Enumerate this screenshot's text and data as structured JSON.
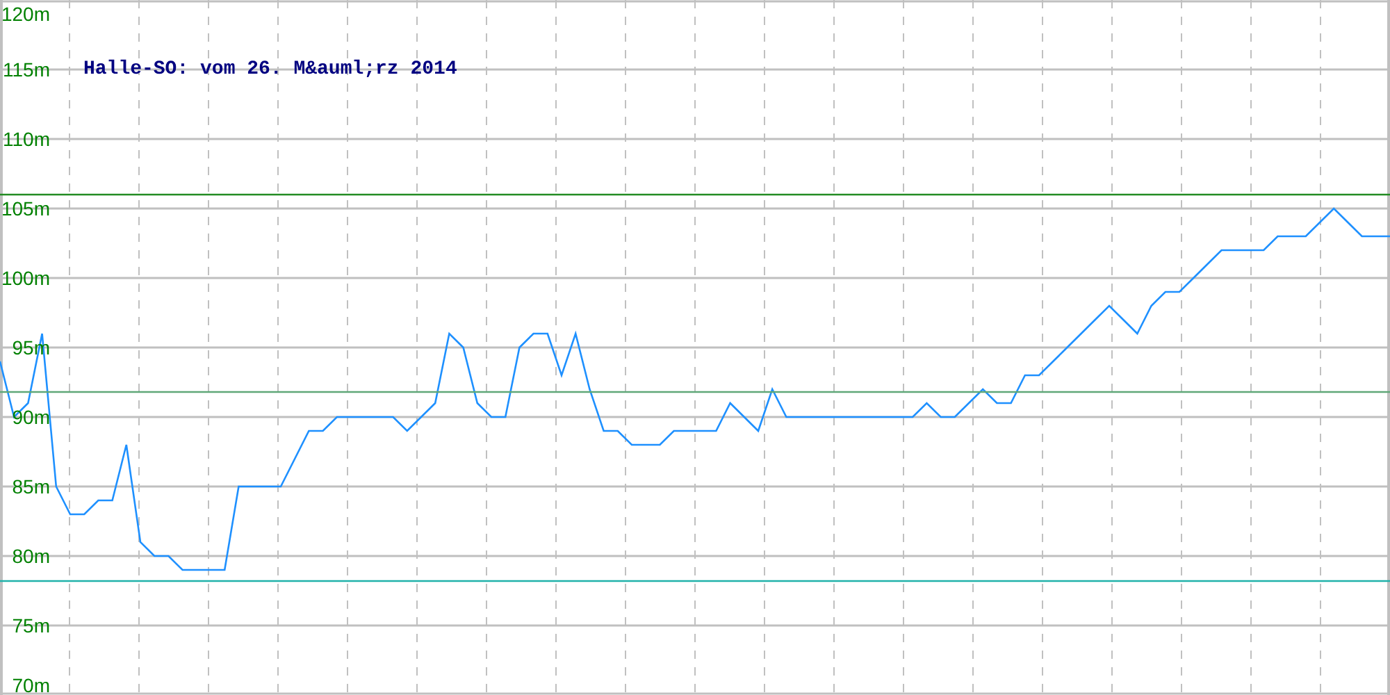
{
  "chart": {
    "chart_data": {
      "type": "line",
      "title": "Halle-SO: vom 26. M&auml;rz 2014",
      "ylim": [
        70,
        120
      ],
      "yticks": [
        {
          "value": 120,
          "label": "120m"
        },
        {
          "value": 115,
          "label": "115m"
        },
        {
          "value": 110,
          "label": "110m"
        },
        {
          "value": 105,
          "label": "105m"
        },
        {
          "value": 100,
          "label": "100m"
        },
        {
          "value": 95,
          "label": "95m"
        },
        {
          "value": 90,
          "label": "90m"
        },
        {
          "value": 85,
          "label": "85m"
        },
        {
          "value": 80,
          "label": "80m"
        },
        {
          "value": 75,
          "label": "75m"
        },
        {
          "value": 70,
          "label": "70m"
        }
      ],
      "series": [
        {
          "color": "#1e90ff",
          "values": [
            94,
            90,
            91,
            96,
            85,
            83,
            83,
            84,
            84,
            88,
            81,
            80,
            80,
            79,
            79,
            79,
            79,
            85,
            85,
            85,
            85,
            87,
            89,
            89,
            90,
            90,
            90,
            90,
            90,
            89,
            90,
            91,
            96,
            95,
            91,
            90,
            90,
            95,
            96,
            96,
            93,
            96,
            92,
            89,
            89,
            88,
            88,
            88,
            89,
            89,
            89,
            89,
            91,
            90,
            89,
            92,
            90,
            90,
            90,
            90,
            90,
            90,
            90,
            90,
            90,
            90,
            91,
            90,
            90,
            91,
            92,
            91,
            91,
            93,
            93,
            94,
            95,
            96,
            97,
            98,
            97,
            96,
            98,
            99,
            99,
            100,
            101,
            102,
            102,
            102,
            102,
            103,
            103,
            103,
            104,
            105,
            104,
            103,
            103,
            103
          ]
        },
        {
          "color": "#228b22",
          "values": [
            106,
            106,
            106,
            106,
            106,
            106,
            106,
            106,
            106,
            106,
            106,
            106,
            106,
            106,
            106,
            106,
            106,
            106,
            106,
            106,
            106,
            106,
            106,
            106,
            106,
            106,
            106,
            106,
            106,
            106,
            106,
            106,
            106,
            106,
            106,
            106,
            106,
            106,
            106,
            106,
            106,
            106,
            106,
            106,
            106,
            106,
            106,
            106,
            106,
            106,
            106,
            106,
            106,
            106,
            106,
            106,
            106,
            106,
            106,
            106,
            106,
            106,
            106,
            106,
            106,
            106,
            106,
            106,
            106,
            106,
            106,
            106,
            106,
            106,
            106,
            106,
            106,
            106,
            106,
            106,
            106,
            106,
            106,
            106,
            106,
            106,
            106,
            106,
            106,
            106,
            106,
            106,
            106,
            106,
            106,
            106,
            106,
            106,
            106,
            106
          ]
        },
        {
          "color": "#5fa878",
          "values": [
            91.8,
            91.8,
            91.8,
            91.8,
            91.8,
            91.8,
            91.8,
            91.8,
            91.8,
            91.8,
            91.8,
            91.8,
            91.8,
            91.8,
            91.8,
            91.8,
            91.8,
            91.8,
            91.8,
            91.8,
            91.8,
            91.8,
            91.8,
            91.8,
            91.8,
            91.8,
            91.8,
            91.8,
            91.8,
            91.8,
            91.8,
            91.8,
            91.8,
            91.8,
            91.8,
            91.8,
            91.8,
            91.8,
            91.8,
            91.8,
            91.8,
            91.8,
            91.8,
            91.8,
            91.8,
            91.8,
            91.8,
            91.8,
            91.8,
            91.8,
            91.8,
            91.8,
            91.8,
            91.8,
            91.8,
            91.8,
            91.8,
            91.8,
            91.8,
            91.8,
            91.8,
            91.8,
            91.8,
            91.8,
            91.8,
            91.8,
            91.8,
            91.8,
            91.8,
            91.8,
            91.8,
            91.8,
            91.8,
            91.8,
            91.8,
            91.8,
            91.8,
            91.8,
            91.8,
            91.8,
            91.8,
            91.8,
            91.8,
            91.8,
            91.8,
            91.8,
            91.8,
            91.8,
            91.8,
            91.8,
            91.8,
            91.8,
            91.8,
            91.8,
            91.8,
            91.8,
            91.8,
            91.8,
            91.8,
            91.8
          ]
        },
        {
          "color": "#20b2aa",
          "values": [
            78.2,
            78.2,
            78.2,
            78.2,
            78.2,
            78.2,
            78.2,
            78.2,
            78.2,
            78.2,
            78.2,
            78.2,
            78.2,
            78.2,
            78.2,
            78.2,
            78.2,
            78.2,
            78.2,
            78.2,
            78.2,
            78.2,
            78.2,
            78.2,
            78.2,
            78.2,
            78.2,
            78.2,
            78.2,
            78.2,
            78.2,
            78.2,
            78.2,
            78.2,
            78.2,
            78.2,
            78.2,
            78.2,
            78.2,
            78.2,
            78.2,
            78.2,
            78.2,
            78.2,
            78.2,
            78.2,
            78.2,
            78.2,
            78.2,
            78.2,
            78.2,
            78.2,
            78.2,
            78.2,
            78.2,
            78.2,
            78.2,
            78.2,
            78.2,
            78.2,
            78.2,
            78.2,
            78.2,
            78.2,
            78.2,
            78.2,
            78.2,
            78.2,
            78.2,
            78.2,
            78.2,
            78.2,
            78.2,
            78.2,
            78.2,
            78.2,
            78.2,
            78.2,
            78.2,
            78.2,
            78.2,
            78.2,
            78.2,
            78.2,
            78.2,
            78.2,
            78.2,
            78.2,
            78.2,
            78.2,
            78.2,
            78.2,
            78.2,
            78.2,
            78.2,
            78.2,
            78.2,
            78.2,
            78.2,
            78.2
          ]
        }
      ],
      "grid": true
    }
  }
}
